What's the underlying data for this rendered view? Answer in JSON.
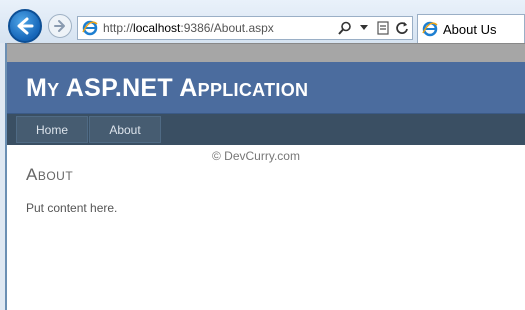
{
  "browser": {
    "address": {
      "protocol": "http://",
      "host": "localhost",
      "path": ":9386/About.aspx"
    },
    "tab": {
      "title": "About Us"
    },
    "icons": [
      "back-arrow-icon",
      "forward-arrow-icon",
      "ie-logo-icon",
      "search-icon",
      "compatibility-view-icon",
      "refresh-icon"
    ]
  },
  "site": {
    "title": "My ASP.NET Application",
    "menu": [
      {
        "label": "Home"
      },
      {
        "label": "About"
      }
    ],
    "watermark": "© DevCurry.com",
    "heading": "About",
    "content": "Put content here."
  },
  "colors": {
    "header": "#4b6c9e",
    "menubar": "#3a4f63",
    "menu_item": "#465c71"
  }
}
